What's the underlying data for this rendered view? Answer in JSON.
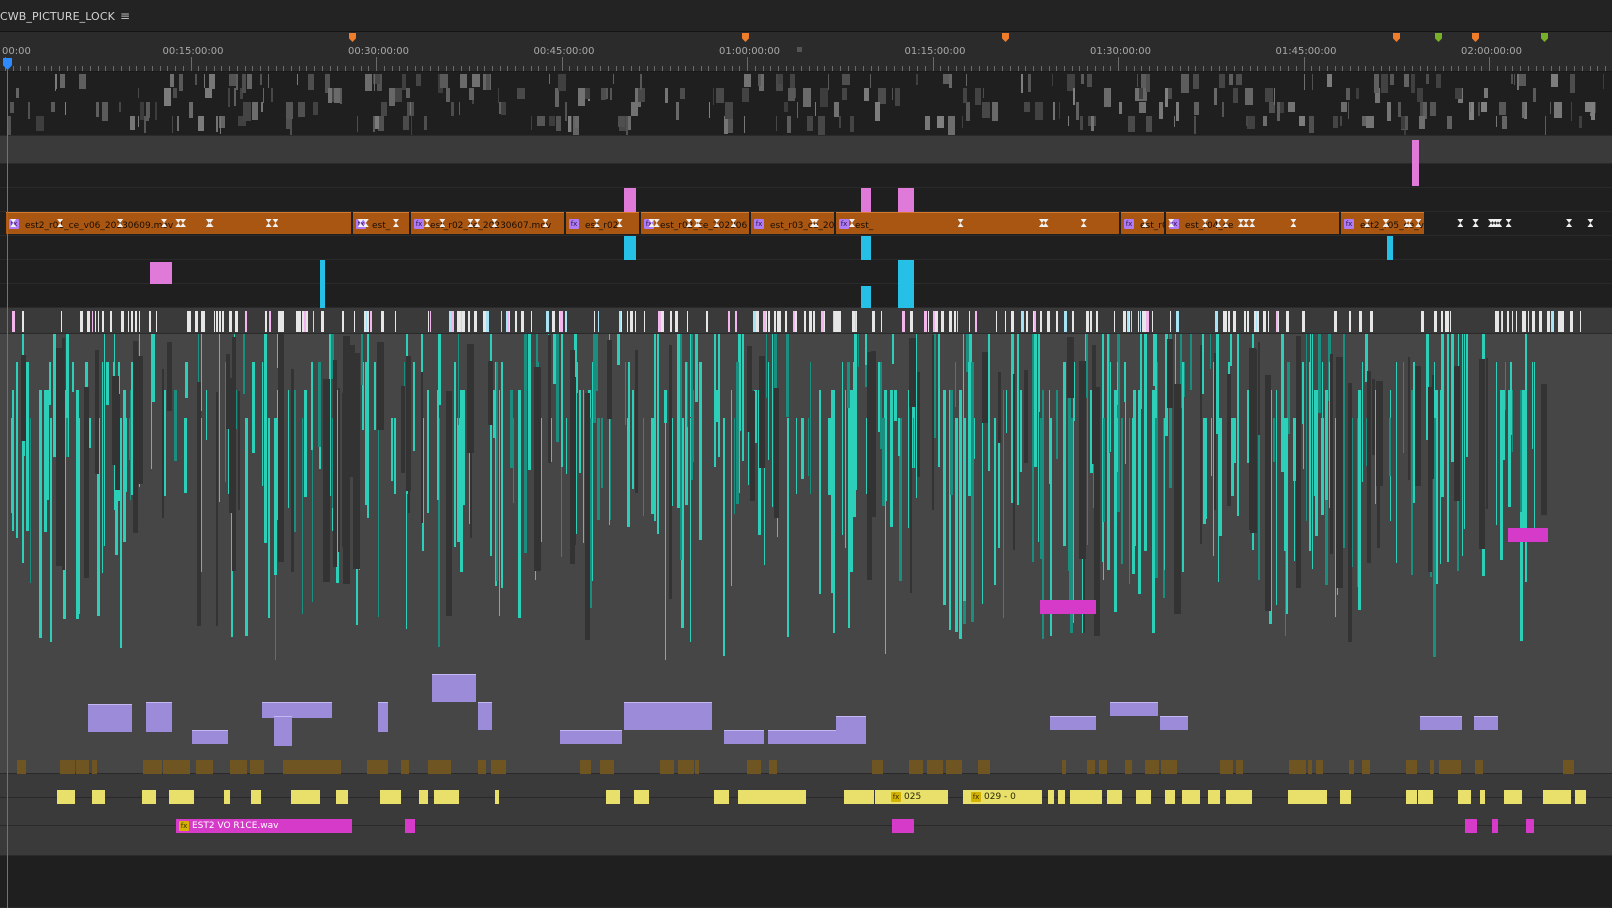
{
  "sequence": {
    "tab_label": "CWB_PICTURE_LOCK",
    "menu_icon": "hamburger-menu-icon"
  },
  "ruler": {
    "timecodes": [
      "00:00",
      "00:15:00:00",
      "00:30:00:00",
      "00:45:00:00",
      "01:00:00:00",
      "01:15:00:00",
      "01:30:00:00",
      "01:45:00:00",
      "02:00:00:00"
    ]
  },
  "colors": {
    "video_clip": "#a95612",
    "teal_audio": "#2ccfb7",
    "pink": "#e07ad9",
    "cyan": "#26bfe6",
    "lavender": "#9b8bd8",
    "yellow": "#e8e06a",
    "magenta": "#d63ac8",
    "marker_orange": "#ef7d2a",
    "marker_green": "#79b02a",
    "playhead": "#2e8bff"
  },
  "video_clips": [
    "est2_r01_ce_v06_20230609.mov",
    "est_",
    "est_r02_ce_20230607.mov",
    "est_r02",
    "est_r02_ce_202306",
    "est_r03_ce_202",
    "est_",
    "est_r04_ce_2023",
    "est_r04_ce",
    "est2_r05_ce_v06_20230"
  ],
  "audio_clip_labels": [
    "025",
    "029 - 0",
    "EST2 VO R1CE.wav"
  ]
}
